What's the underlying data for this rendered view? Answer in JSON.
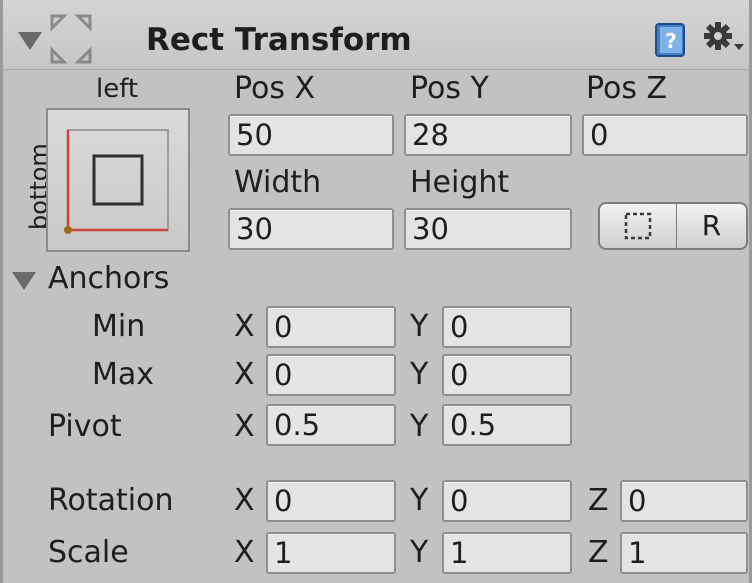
{
  "component": {
    "title": "Rect Transform",
    "help_icon": "help-book-icon",
    "settings_icon": "gear-dropdown-icon"
  },
  "anchor_preset": {
    "top_label": "left",
    "side_label": "bottom",
    "colors": {
      "anchor_line": "#c8453c",
      "pivot_dot": "#9a6b1a"
    }
  },
  "position": {
    "pos_x": {
      "label": "Pos X",
      "value": "50"
    },
    "pos_y": {
      "label": "Pos Y",
      "value": "28"
    },
    "pos_z": {
      "label": "Pos Z",
      "value": "0"
    }
  },
  "size": {
    "width": {
      "label": "Width",
      "value": "30"
    },
    "height": {
      "label": "Height",
      "value": "30"
    }
  },
  "buttons": {
    "blueprint_icon": "dotted-rect-icon",
    "raw_edit_label": "R"
  },
  "anchors": {
    "label": "Anchors",
    "min": {
      "label": "Min",
      "x_label": "X",
      "x": "0",
      "y_label": "Y",
      "y": "0"
    },
    "max": {
      "label": "Max",
      "x_label": "X",
      "x": "0",
      "y_label": "Y",
      "y": "0"
    }
  },
  "pivot": {
    "label": "Pivot",
    "x_label": "X",
    "x": "0.5",
    "y_label": "Y",
    "y": "0.5"
  },
  "rotation": {
    "label": "Rotation",
    "x_label": "X",
    "x": "0",
    "y_label": "Y",
    "y": "0",
    "z_label": "Z",
    "z": "0"
  },
  "scale": {
    "label": "Scale",
    "x_label": "X",
    "x": "1",
    "y_label": "Y",
    "y": "1",
    "z_label": "Z",
    "z": "1"
  }
}
